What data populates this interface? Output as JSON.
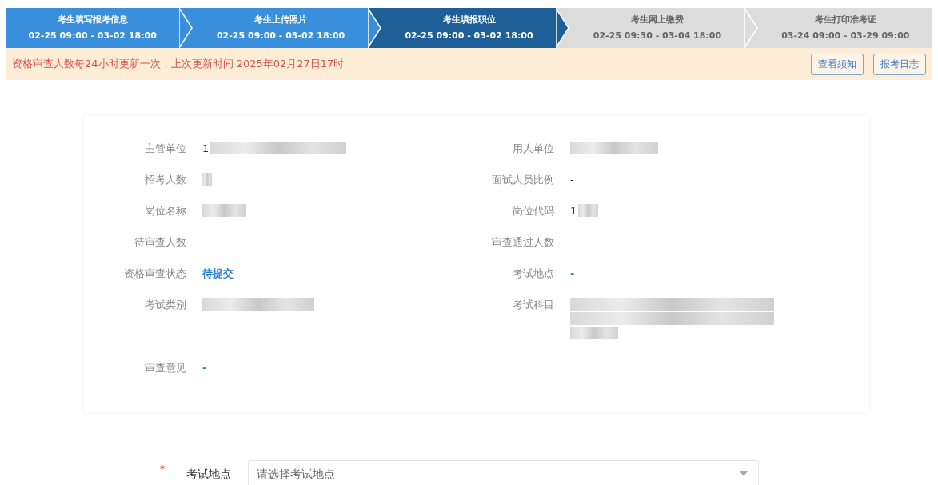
{
  "steps": [
    {
      "title": "考生填写报考信息",
      "time": "02-25 09:00 - 03-02 18:00",
      "selected": false
    },
    {
      "title": "考生上传照片",
      "time": "02-25 09:00 - 03-02 18:00",
      "selected": false
    },
    {
      "title": "考生填报职位",
      "time": "02-25 09:00 - 03-02 18:00",
      "selected": true
    },
    {
      "title": "考生网上缴费",
      "time": "02-25 09:30 - 03-04 18:00",
      "selected": false
    },
    {
      "title": "考生打印准考证",
      "time": "03-24 09:00 - 03-29 09:00",
      "selected": false
    }
  ],
  "notice": {
    "message": "资格审查人数每24小时更新一次，上次更新时间 2025年02月27日17时",
    "buttons": [
      "查看须知",
      "报考日志"
    ]
  },
  "details": {
    "left": [
      {
        "label": "主管单位",
        "kind": "redacted",
        "prefix": "1"
      },
      {
        "label": "招考人数",
        "kind": "redacted"
      },
      {
        "label": "岗位名称",
        "kind": "redacted"
      },
      {
        "label": "待审查人数",
        "kind": "plain",
        "value": "-"
      },
      {
        "label": "资格审查状态",
        "kind": "status",
        "value": "待提交"
      },
      {
        "label": "考试类别",
        "kind": "redacted"
      },
      {
        "label": "审查意见",
        "kind": "status",
        "value": "-"
      }
    ],
    "right": [
      {
        "label": "用人单位",
        "kind": "redacted"
      },
      {
        "label": "面试人员比例",
        "kind": "plain",
        "value": "-"
      },
      {
        "label": "岗位代码",
        "kind": "redacted",
        "prefix": "1"
      },
      {
        "label": "审查通过人数",
        "kind": "plain",
        "value": "-"
      },
      {
        "label": "考试地点",
        "kind": "status",
        "value": "-"
      },
      {
        "label": "考试科目",
        "kind": "redacted-block"
      }
    ]
  },
  "form": {
    "required_mark": "*",
    "label": "考试地点",
    "placeholder": "请选择考试地点"
  }
}
